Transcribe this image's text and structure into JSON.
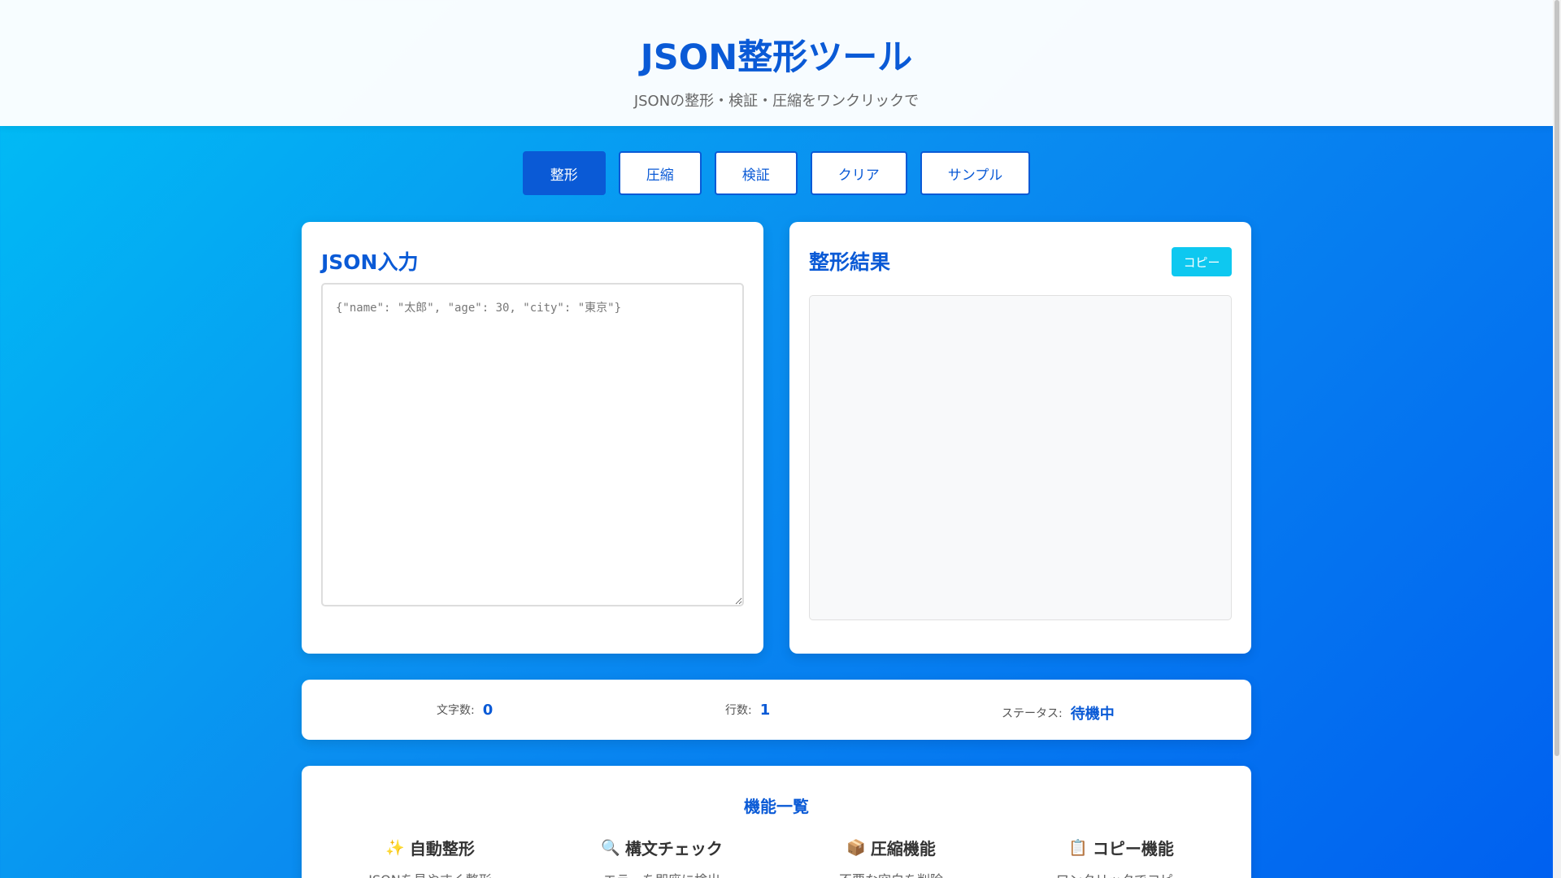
{
  "header": {
    "title": "JSON整形ツール",
    "subtitle": "JSONの整形・検証・圧縮をワンクリックで"
  },
  "toolbar": {
    "buttons": [
      {
        "label": "整形",
        "active": true
      },
      {
        "label": "圧縮",
        "active": false
      },
      {
        "label": "検証",
        "active": false
      },
      {
        "label": "クリア",
        "active": false
      },
      {
        "label": "サンプル",
        "active": false
      }
    ]
  },
  "input_panel": {
    "title": "JSON入力",
    "value": "",
    "placeholder": "{\"name\": \"太郎\", \"age\": 30, \"city\": \"東京\"}"
  },
  "output_panel": {
    "title": "整形結果",
    "copy_label": "コピー",
    "value": ""
  },
  "stats": {
    "chars_label": "文字数:",
    "chars_value": "0",
    "lines_label": "行数:",
    "lines_value": "1",
    "status_label": "ステータス:",
    "status_value": "待機中"
  },
  "features": {
    "title": "機能一覧",
    "items": [
      {
        "icon": "sparkles-icon",
        "glyph": "✨",
        "title": "自動整形",
        "desc": "JSONを見やすく整形"
      },
      {
        "icon": "magnifier-icon",
        "glyph": "🔍",
        "title": "構文チェック",
        "desc": "エラーを即座に検出"
      },
      {
        "icon": "package-icon",
        "glyph": "📦",
        "title": "圧縮機能",
        "desc": "不要な空白を削除"
      },
      {
        "icon": "clipboard-icon",
        "glyph": "📋",
        "title": "コピー機能",
        "desc": "ワンクリックでコピー"
      }
    ]
  },
  "colors": {
    "accent": "#0a5ad6",
    "copy_button": "#0ec8f0",
    "background_start": "#00bff5",
    "background_end": "#0060f0"
  }
}
